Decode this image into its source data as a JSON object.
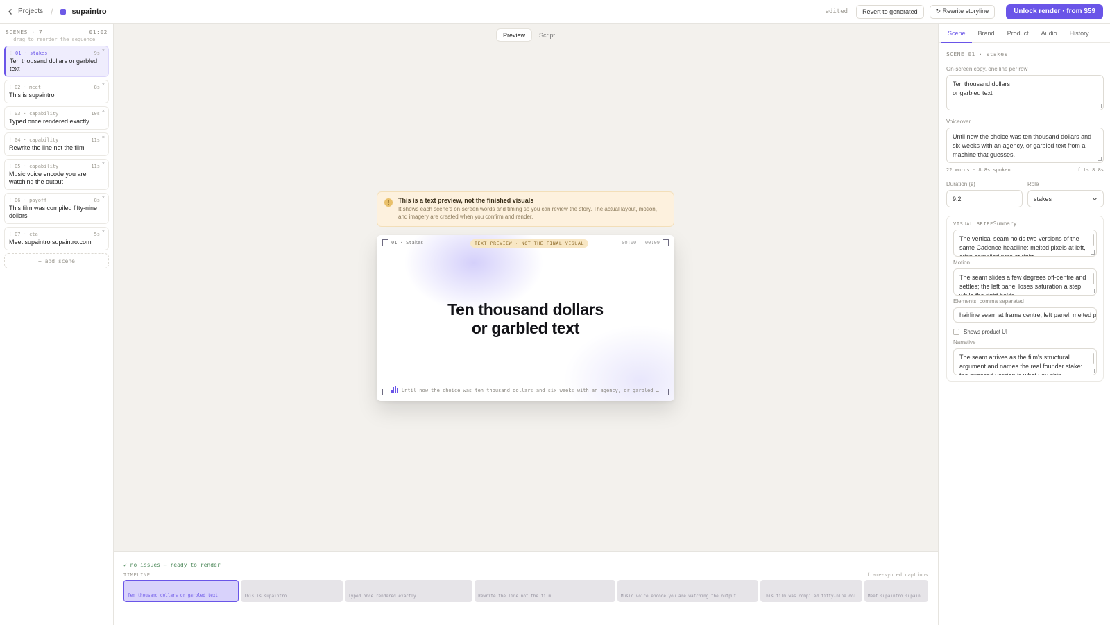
{
  "topbar": {
    "back_label": "Projects",
    "project_name": "supaintro",
    "status": "edited",
    "revert_label": "Revert to generated",
    "rewrite_label": "↻ Rewrite storyline",
    "unlock_label": "Unlock render · from $59",
    "accent": "#6a55e8"
  },
  "sidebar": {
    "header": "SCENES · 7",
    "total_time": "01:02",
    "hint": "⋮ drag to reorder the sequence",
    "add_label": "+ add scene",
    "scenes": [
      {
        "meta": "01 · stakes",
        "dur": "9s",
        "title": "Ten thousand dollars or garbled text"
      },
      {
        "meta": "02 · meet",
        "dur": "8s",
        "title": "This is supaintro"
      },
      {
        "meta": "03 · capability",
        "dur": "10s",
        "title": "Typed once rendered exactly"
      },
      {
        "meta": "04 · capability",
        "dur": "11s",
        "title": "Rewrite the line not the film"
      },
      {
        "meta": "05 · capability",
        "dur": "11s",
        "title": "Music voice encode you are watching the output"
      },
      {
        "meta": "06 · payoff",
        "dur": "8s",
        "title": "This film was compiled fifty-nine dollars"
      },
      {
        "meta": "07 · cta",
        "dur": "5s",
        "title": "Meet supaintro supaintro.com"
      }
    ]
  },
  "center": {
    "tabs": [
      "Preview",
      "Script"
    ],
    "notice_title": "This is a text preview, not the finished visuals",
    "notice_body": "It shows each scene's on-screen words and timing so you can review the story. The actual layout, motion, and imagery are created when you confirm and render.",
    "preview": {
      "label": "01 · Stakes",
      "badge": "TEXT PREVIEW · NOT THE FINAL VISUAL",
      "time": "00:00 – 00:09",
      "line1": "Ten thousand dollars",
      "line2": "or garbled text",
      "voiceover": "Until now the choice was ten thousand dollars and six weeks with an agency, or garbled text from a machine that guesses."
    }
  },
  "timeline": {
    "status": "✓ no issues — ready to render",
    "label": "TIMELINE",
    "captions": "frame-synced captions",
    "segments": [
      {
        "label": "Ten thousand dollars or garbled text",
        "duration_s": 9
      },
      {
        "label": "This is supaintro",
        "duration_s": 8
      },
      {
        "label": "Typed once rendered exactly",
        "duration_s": 10
      },
      {
        "label": "Rewrite the line not the film",
        "duration_s": 11
      },
      {
        "label": "Music voice encode you are watching the output",
        "duration_s": 11
      },
      {
        "label": "This film was compiled fifty-nine dollars",
        "duration_s": 8
      },
      {
        "label": "Meet supaintro supaintro.com",
        "duration_s": 5
      }
    ]
  },
  "panel": {
    "tabs": [
      "Scene",
      "Brand",
      "Product",
      "Audio",
      "History"
    ],
    "scene_label": "SCENE 01 · stakes",
    "copy_label": "On-screen copy, one line per row",
    "copy_line1": "Ten thousand dollars",
    "copy_line2": "or garbled text",
    "vo_label": "Voiceover",
    "vo_text": "Until now the choice was ten thousand dollars and six weeks with an agency, or garbled text from a machine that guesses.",
    "vo_stats": "22 words · 8.8s spoken",
    "vo_fit": "fits 8.8s",
    "duration_label": "Duration (s)",
    "duration_value": "9.2",
    "role_label": "Role",
    "role_value": "stakes",
    "brief_head": "VISUAL BRIEF",
    "summary_label": "Summary",
    "summary_text": "The vertical seam holds two versions of the same Cadence headline: melted pixels at left, crisp compiled type at right.",
    "motion_label": "Motion",
    "motion_text": "The seam slides a few degrees off-centre and settles; the left panel loses saturation a step while the right holds.",
    "elements_label": "Elements, comma separated",
    "elements_value": "hairline seam at frame centre, left panel: melted pixels",
    "shows_ui_label": "Shows product UI",
    "narrative_label": "Narrative",
    "narrative_text": "The seam arrives as the film's structural argument and names the real founder stake: the guessed version is what you ship."
  }
}
